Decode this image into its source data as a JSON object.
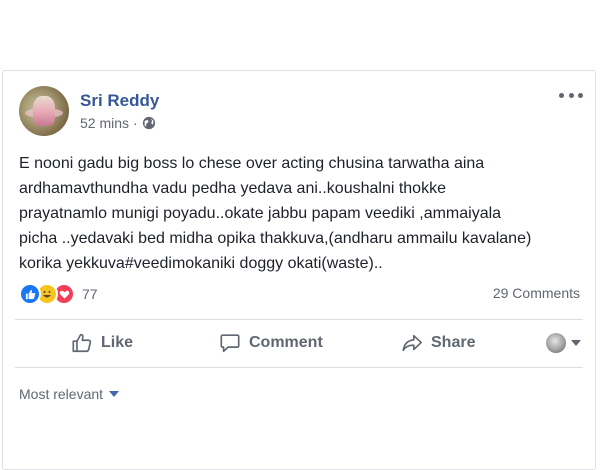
{
  "post": {
    "author": "Sri Reddy",
    "time": "52 mins",
    "separator": "·",
    "lines": [
      "E nooni gadu big boss lo chese over acting chusina tarwatha aina",
      "ardhamavthundha vadu pedha yedava ani..koushalni thokke",
      "prayatnamlo munigi poyadu..okate jabbu papam veediki ,ammaiyala",
      "picha ..yedavaki bed midha opika thakkuva,(andharu ammailu kavalane)",
      "korika yekkuva#veedimokaniki doggy okati(waste).."
    ]
  },
  "stats": {
    "reaction_count": "77",
    "comments": "29 Comments",
    "reaction_types": [
      "like-icon",
      "haha-icon",
      "love-icon"
    ]
  },
  "actions": {
    "like": "Like",
    "comment": "Comment",
    "share": "Share"
  },
  "filter": {
    "label": "Most relevant"
  },
  "colors": {
    "author": "#365899",
    "text": "#1d2129",
    "muted": "#606770",
    "like": "#1877f2",
    "haha": "#f7c31d",
    "love": "#f33e58"
  }
}
